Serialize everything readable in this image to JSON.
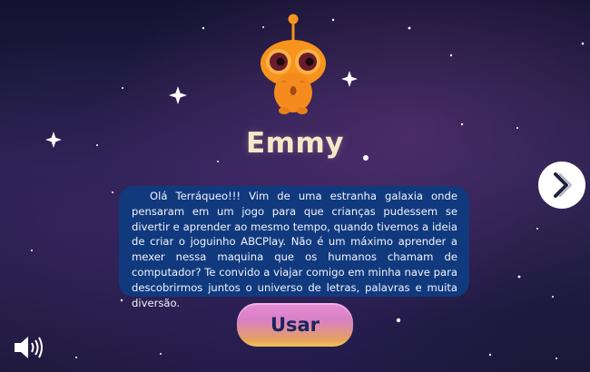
{
  "character": {
    "name": "Emmy",
    "icon": "alien-mascot-icon"
  },
  "dialog": {
    "message": "Olá Terráqueo!!! Vim de uma estranha galaxia onde pensaram em um jogo para que crianças pudessem se divertir e aprender ao mesmo tempo, quando tivemos a ideia de criar o joguinho ABCPlay. Não é um máximo aprender a mexer nessa maquina que os humanos chamam de computador?  Te convido a viajar comigo em minha nave para descobrirmos juntos o universo de letras, palavras e muita diversão."
  },
  "buttons": {
    "use_label": "Usar",
    "next_icon": "chevron-right-icon",
    "sound_icon": "speaker-volume-icon"
  },
  "colors": {
    "background": "#1b1838",
    "message_box": "#113a7e",
    "name_text": "#f6e7c9",
    "use_button_top": "#e88bd6",
    "use_button_bottom": "#f2c35a",
    "use_button_text": "#1c2560",
    "mascot_body": "#f7941d"
  }
}
